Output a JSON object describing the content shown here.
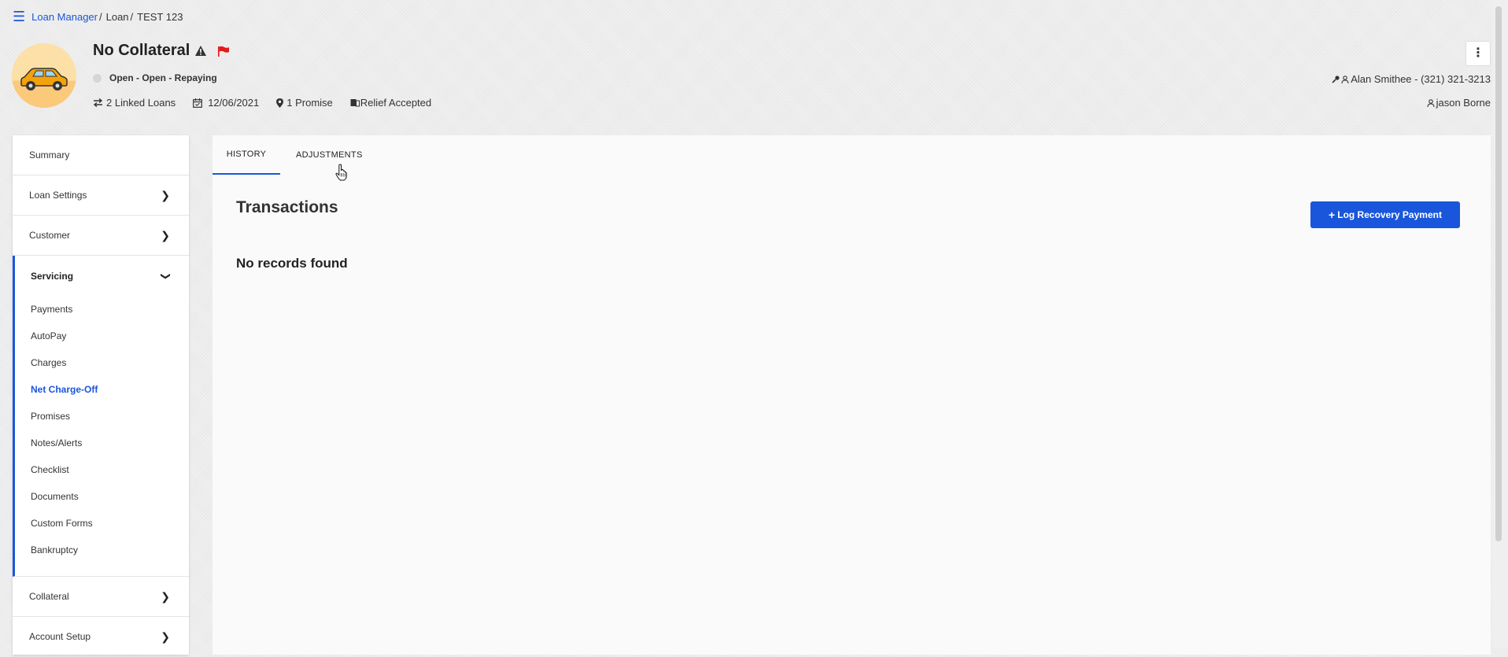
{
  "breadcrumb": {
    "root": "Loan Manager",
    "sep1": "/",
    "middle": "Loan",
    "sep2": "/",
    "current": "TEST 123"
  },
  "header": {
    "title": "No Collateral",
    "status": "Open - Open - Repaying",
    "linked_loans": "2 Linked Loans",
    "date": "12/06/2021",
    "promise": "1 Promise",
    "relief": "Relief Accepted",
    "contact": "Alan Smithee - (321) 321-3213",
    "agent": "jason Borne",
    "flag_color": "#e21b1b"
  },
  "sidebar": {
    "summary": "Summary",
    "loan_settings": "Loan Settings",
    "customer": "Customer",
    "servicing": {
      "label": "Servicing",
      "items": [
        "Payments",
        "AutoPay",
        "Charges",
        "Net Charge-Off",
        "Promises",
        "Notes/Alerts",
        "Checklist",
        "Documents",
        "Custom Forms",
        "Bankruptcy"
      ],
      "active": "Net Charge-Off"
    },
    "collateral": "Collateral",
    "account_setup": "Account Setup"
  },
  "main": {
    "tabs": [
      "HISTORY",
      "ADJUSTMENTS"
    ],
    "active_tab": "HISTORY",
    "section_title": "Transactions",
    "empty_message": "No records found",
    "log_button": "Log Recovery Payment"
  },
  "colors": {
    "accent": "#1a56db"
  }
}
